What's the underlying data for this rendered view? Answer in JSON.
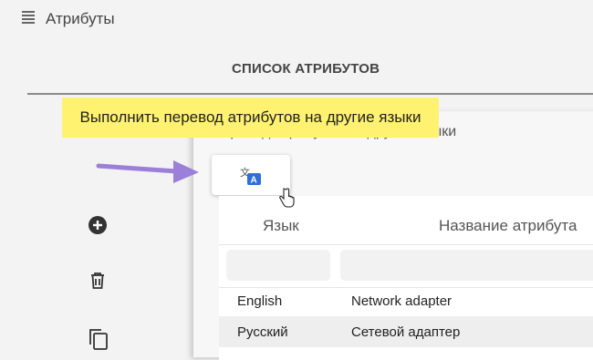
{
  "app": {
    "title": "Атрибуты"
  },
  "page": {
    "heading": "СПИСОК АТРИБУТОВ"
  },
  "sidebar": {
    "icons": [
      "add-circle-icon",
      "trash-icon",
      "copy-icon"
    ]
  },
  "panel": {
    "subtitle": "Перевод атрибутов на другие языки",
    "translate_button_icon": "translate-icon",
    "table": {
      "headers": [
        "Язык",
        "Название атрибута"
      ],
      "rows": [
        {
          "language": "English",
          "name": "Network adapter"
        },
        {
          "language": "Русский",
          "name": "Сетевой адаптер"
        }
      ]
    }
  },
  "tooltip": {
    "text": "Выполнить перевод атрибутов на другие языки"
  },
  "colors": {
    "tooltip_bg": "#fff270",
    "arrow": "#9b7fd8",
    "translate_accent": "#2f6fd6"
  }
}
